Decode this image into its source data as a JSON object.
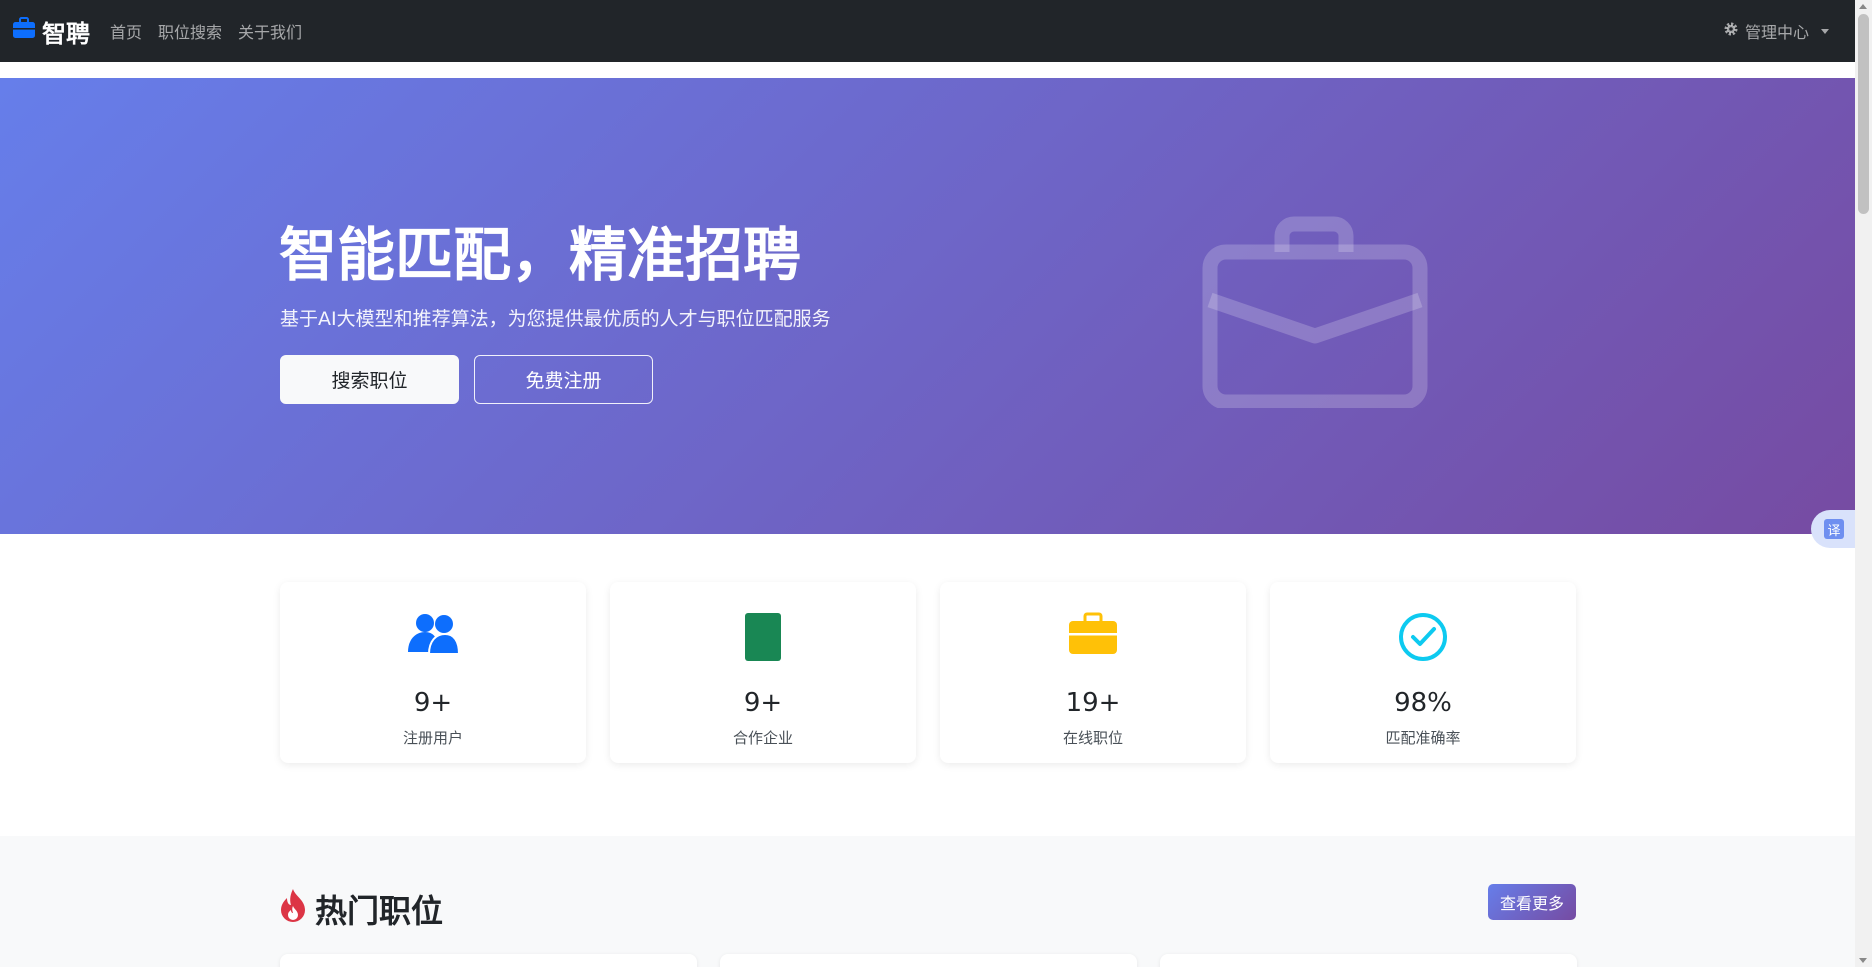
{
  "navbar": {
    "brand": "智聘",
    "links": [
      "首页",
      "职位搜索",
      "关于我们"
    ],
    "admin": "管理中心"
  },
  "hero": {
    "title": "智能匹配，精准招聘",
    "subtitle": "基于AI大模型和推荐算法，为您提供最优质的人才与职位匹配服务",
    "primary_button": "搜索职位",
    "secondary_button": "免费注册"
  },
  "translate": {
    "label": "译"
  },
  "stats": [
    {
      "value": "9+",
      "label": "注册用户",
      "icon": "people-icon",
      "color": "#0d6efd"
    },
    {
      "value": "9+",
      "label": "合作企业",
      "icon": "building-icon",
      "color": "#198754"
    },
    {
      "value": "19+",
      "label": "在线职位",
      "icon": "briefcase-icon",
      "color": "#ffc107"
    },
    {
      "value": "98%",
      "label": "匹配准确率",
      "icon": "check-circle-icon",
      "color": "#0dcaf0"
    }
  ],
  "hot_jobs": {
    "title": "热门职位",
    "more_button": "查看更多"
  },
  "colors": {
    "navbar": "#212529",
    "hero_start": "#667eea",
    "hero_end": "#764ba2",
    "fire": "#dc3545"
  }
}
